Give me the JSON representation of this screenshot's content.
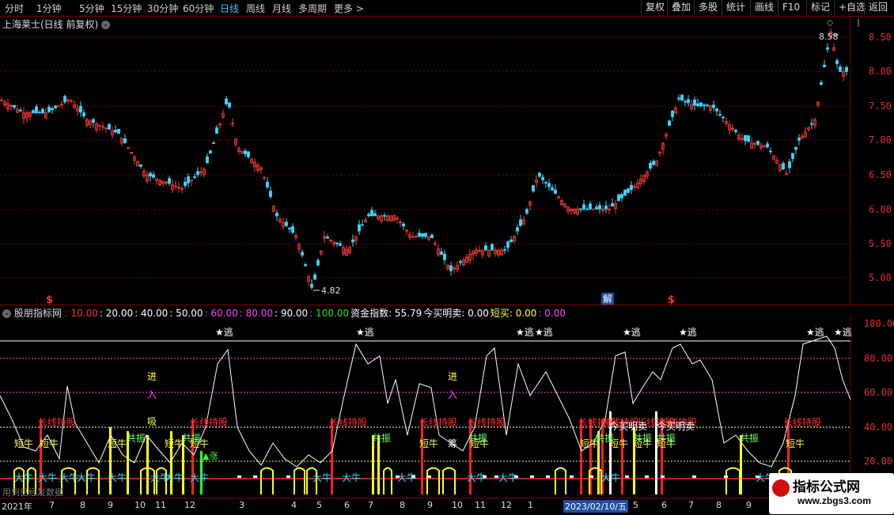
{
  "toolbar": {
    "periods": [
      "分时",
      "1分钟",
      "5分钟",
      "15分钟",
      "30分钟",
      "60分钟",
      "日线",
      "周线",
      "月线",
      "多周期",
      "更多 >"
    ],
    "active_period": "日线",
    "buttons": [
      "复权",
      "叠加",
      "多股",
      "统计",
      "画线",
      "F10",
      "标记",
      "+自选",
      "返回"
    ]
  },
  "main_chart": {
    "title": "上海莱士(日线 前复权)",
    "high_label": "8.58",
    "low_label": "4.82",
    "y_ticks": [
      "8.50",
      "8.00",
      "7.50",
      "7.00",
      "6.50",
      "6.00",
      "5.50",
      "5.00"
    ],
    "markers": [
      "$",
      "解",
      "$"
    ]
  },
  "indicator": {
    "name": "股朋指标网",
    "legend": [
      {
        "text": ": 10.00",
        "color": "#ff3030"
      },
      {
        "text": ": 20.00",
        "color": "#ffffff"
      },
      {
        "text": ": 40.00",
        "color": "#ffffff"
      },
      {
        "text": ": 50.00",
        "color": "#ffffff"
      },
      {
        "text": ": 60.00",
        "color": "#ff44ff"
      },
      {
        "text": ": 80.00",
        "color": "#ff44ff"
      },
      {
        "text": ": 90.00",
        "color": "#ffffff"
      },
      {
        "text": ": 100.00",
        "color": "#33dd33"
      },
      {
        "text": "资金指数: 55.79",
        "color": "#ffffff"
      },
      {
        "text": "今买明卖: 0.00",
        "color": "#ffffff"
      },
      {
        "text": "短买: 0.00",
        "color": "#ffff33"
      },
      {
        "text": ": 0.00",
        "color": "#ff44ff"
      }
    ],
    "y_ticks": [
      "100.00",
      "80.00",
      "60.00",
      "40.00",
      "20.00"
    ],
    "labels": {
      "escape": "★逃",
      "long_hold": "长线持股",
      "short_bull": "短牛",
      "big_bull": "大牛",
      "resonance": "共振",
      "enter": "进",
      "buy_in": "入",
      "absorb": "吸",
      "chips": "筹",
      "rise": "▲涨",
      "jintmai": "今买明卖"
    }
  },
  "date_axis": {
    "labels": [
      "2021年",
      "7",
      "8",
      "9",
      "10",
      "11",
      "12",
      "3",
      "4",
      "5",
      "6",
      "7",
      "8",
      "9",
      "10",
      "11",
      "12",
      "1",
      "2023/02/10/五",
      "5",
      "6",
      "7",
      "8",
      "9"
    ],
    "selected": "2023/02/10/五"
  },
  "watermark": {
    "title": "指标公式网",
    "url": "www.zbgs3.com",
    "footer": "用到已经发数据"
  }
}
